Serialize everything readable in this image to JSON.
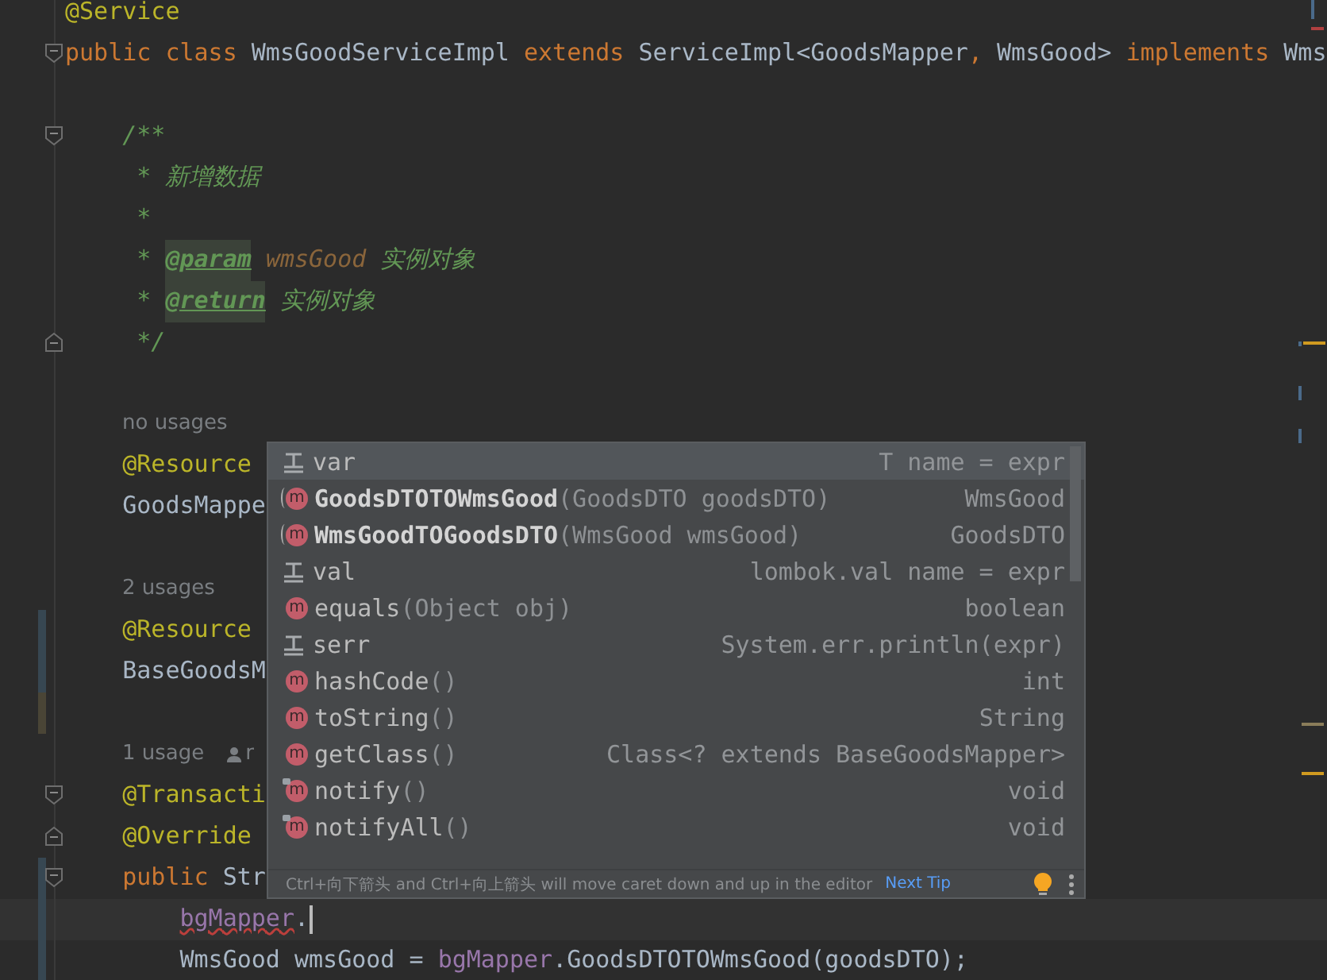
{
  "editor": {
    "lines": [
      {
        "fold_start": false,
        "fold_end": false,
        "tokens": [
          {
            "kind": "annotation",
            "text": "@Service"
          }
        ]
      },
      {
        "fold_start": true,
        "fold_end": false,
        "tokens": [
          {
            "kind": "keyword",
            "text": "public class "
          },
          {
            "kind": "plain",
            "text": "WmsGoodServiceImpl "
          },
          {
            "kind": "keyword",
            "text": "extends "
          },
          {
            "kind": "plain",
            "text": "ServiceImpl<GoodsMapper"
          },
          {
            "kind": "keyword",
            "text": ", "
          },
          {
            "kind": "plain",
            "text": "WmsGood> "
          },
          {
            "kind": "keyword",
            "text": "implements "
          },
          {
            "kind": "plain",
            "text": "Wms"
          }
        ]
      },
      {
        "fold_start": false,
        "fold_end": false
      },
      {
        "fold_start": true,
        "fold_end": false,
        "tokens": [
          {
            "kind": "doc",
            "text": "    /**"
          }
        ]
      },
      {
        "fold_start": false,
        "fold_end": false,
        "tokens": [
          {
            "kind": "doc",
            "text": "     * 新增数据"
          }
        ]
      },
      {
        "fold_start": false,
        "fold_end": false,
        "tokens": [
          {
            "kind": "doc",
            "text": "     *"
          }
        ]
      },
      {
        "fold_start": false,
        "fold_end": false,
        "tokens": [
          {
            "kind": "doc",
            "text": "     * "
          },
          {
            "kind": "doctag",
            "text": "@param"
          },
          {
            "kind": "docparam",
            "text": " wmsGood"
          },
          {
            "kind": "doc",
            "text": " 实例对象"
          }
        ]
      },
      {
        "fold_start": false,
        "fold_end": false,
        "tokens": [
          {
            "kind": "doc",
            "text": "     * "
          },
          {
            "kind": "doctag",
            "text": "@return"
          },
          {
            "kind": "doc",
            "text": " 实例对象"
          }
        ]
      },
      {
        "fold_start": false,
        "fold_end": true,
        "tokens": [
          {
            "kind": "doc",
            "text": "     */"
          }
        ]
      },
      {
        "fold_start": false,
        "fold_end": false
      },
      {
        "fold_start": false,
        "fold_end": false,
        "tokens": [
          {
            "kind": "inlay",
            "text": "no usages"
          }
        ]
      },
      {
        "fold_start": false,
        "fold_end": false,
        "tokens": [
          {
            "kind": "annotation",
            "text": "    @Resource"
          }
        ]
      },
      {
        "fold_start": false,
        "fold_end": false,
        "tokens": [
          {
            "kind": "plain",
            "text": "    GoodsMappe"
          }
        ]
      },
      {
        "fold_start": false,
        "fold_end": false
      },
      {
        "fold_start": false,
        "fold_end": false,
        "tokens": [
          {
            "kind": "inlay",
            "text": "2 usages"
          }
        ]
      },
      {
        "fold_start": false,
        "fold_end": false,
        "color": "#374752",
        "tokens": [
          {
            "kind": "annotation",
            "text": "    @Resource"
          }
        ]
      },
      {
        "fold_start": false,
        "fold_end": false,
        "color": "#374752",
        "tokens": [
          {
            "kind": "plain",
            "text": "    BaseGoodsM"
          }
        ]
      },
      {
        "fold_start": false,
        "fold_end": false,
        "color": "#4a4536"
      },
      {
        "fold_start": false,
        "fold_end": false,
        "tokens": [
          {
            "kind": "inlay",
            "text": "1 usage"
          },
          {
            "kind": "author",
            "text": "r"
          }
        ]
      },
      {
        "fold_start": true,
        "fold_end": false,
        "tokens": [
          {
            "kind": "annotation",
            "text": "    @Transacti"
          }
        ]
      },
      {
        "fold_start": false,
        "fold_end": true,
        "tokens": [
          {
            "kind": "annotation",
            "text": "    @Override"
          }
        ]
      },
      {
        "fold_start": true,
        "fold_end": false,
        "color": "#374752",
        "tokens": [
          {
            "kind": "keyword",
            "text": "    public "
          },
          {
            "kind": "plain",
            "text": "Str"
          }
        ]
      },
      {
        "fold_start": false,
        "fold_end": false,
        "current": true,
        "color": "#374752",
        "tokens": [
          {
            "kind": "error-field",
            "text": "        bgMapper"
          },
          {
            "kind": "plain",
            "text": "."
          }
        ]
      },
      {
        "fold_start": false,
        "fold_end": false,
        "color": "#374752",
        "tokens": [
          {
            "kind": "plain",
            "text": "        WmsGood wmsGood = "
          },
          {
            "kind": "field",
            "text": "bgMapper"
          },
          {
            "kind": "plain",
            "text": ".GoodsDTOTOWmsGood(goodsDTO);"
          }
        ]
      }
    ]
  },
  "completion": {
    "items": [
      {
        "kind": "template",
        "name": "var",
        "type": "T name = expr",
        "selected": true
      },
      {
        "kind": "method",
        "badge": "m",
        "name": "GoodsDTOTOWmsGood",
        "params": "(GoodsDTO goodsDTO)",
        "type": "WmsGood",
        "selected": false,
        "bold": true,
        "inherited": false
      },
      {
        "kind": "method",
        "badge": "m",
        "name": "WmsGoodTOGoodsDTO",
        "params": "(WmsGood wmsGood)",
        "type": "GoodsDTO",
        "selected": false,
        "bold": true,
        "inherited": false
      },
      {
        "kind": "template",
        "name": "val",
        "type": "lombok.val name = expr",
        "selected": false
      },
      {
        "kind": "method",
        "badge": "m",
        "name": "equals",
        "params": "(Object obj)",
        "type": "boolean",
        "selected": false,
        "bold": false,
        "inherited": false
      },
      {
        "kind": "template",
        "name": "serr",
        "type": "System.err.println(expr)",
        "selected": false
      },
      {
        "kind": "method",
        "badge": "m",
        "name": "hashCode",
        "params": "()",
        "type": "int",
        "selected": false,
        "bold": false,
        "inherited": false
      },
      {
        "kind": "method",
        "badge": "m",
        "name": "toString",
        "params": "()",
        "type": "String",
        "selected": false,
        "bold": false,
        "inherited": false
      },
      {
        "kind": "method",
        "badge": "m",
        "name": "getClass",
        "params": "()",
        "type": "Class<? extends BaseGoodsMapper>",
        "selected": false,
        "bold": false,
        "inherited": false
      },
      {
        "kind": "method",
        "badge": "m",
        "name": "notify",
        "params": "()",
        "type": "void",
        "selected": false,
        "bold": false,
        "inherited": true
      },
      {
        "kind": "method",
        "badge": "m",
        "name": "notifyAll",
        "params": "()",
        "type": "void",
        "selected": false,
        "bold": false,
        "inherited": true
      }
    ],
    "footer": {
      "hint": "Ctrl+向下箭头 and Ctrl+向上箭头 will move caret down and up in the editor",
      "link": "Next Tip"
    }
  }
}
